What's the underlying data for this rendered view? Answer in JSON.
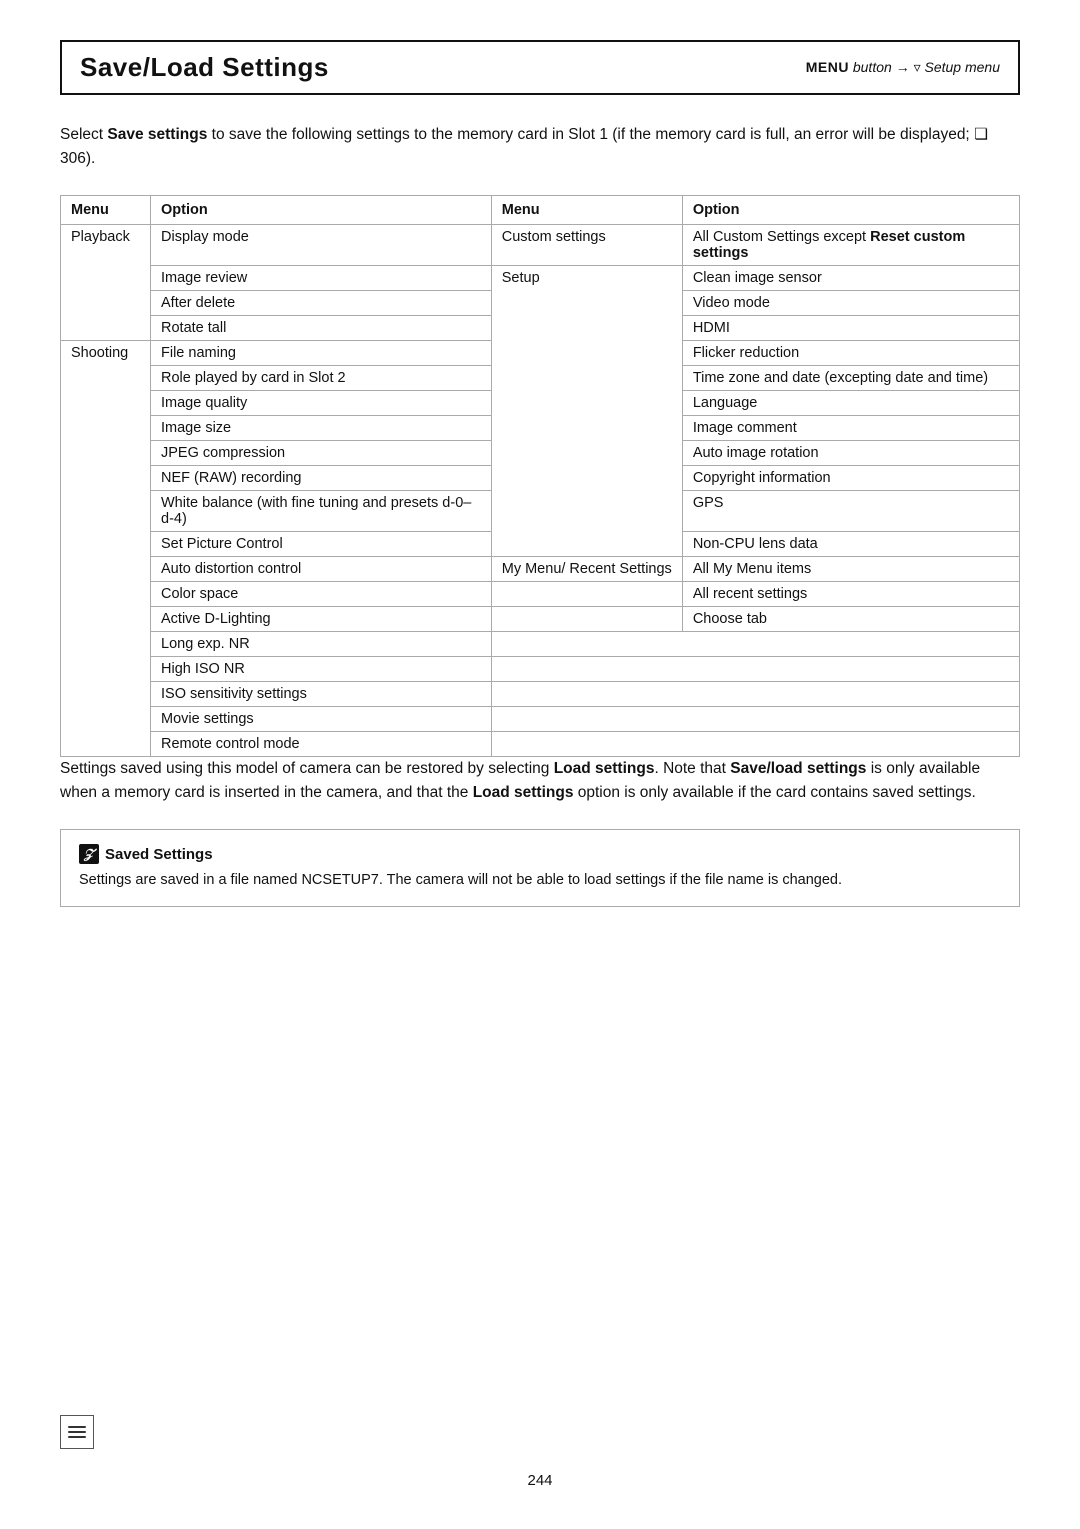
{
  "header": {
    "title": "Save/Load Settings",
    "menu_label": "MENU",
    "menu_italic": "button",
    "arrow": "→",
    "setup_icon": "Y",
    "setup_label": "Setup menu"
  },
  "intro": {
    "text_before": "Select ",
    "bold1": "Save settings",
    "text_middle": " to save the following settings to the memory card in Slot 1 (if the memory card is full, an error will be displayed; ",
    "ref": "❏ 306",
    "text_end": ")."
  },
  "table": {
    "col1_header_menu": "Menu",
    "col1_header_option": "Option",
    "col2_header_menu": "Menu",
    "col2_header_option": "Option",
    "left_rows": [
      {
        "menu": "Playback",
        "options": [
          "Display mode",
          "Image review",
          "After delete",
          "Rotate tall"
        ]
      },
      {
        "menu": "Shooting",
        "options": [
          "File naming",
          "Role played by card in Slot 2",
          "Image quality",
          "Image size",
          "JPEG compression",
          "NEF (RAW) recording",
          "White balance (with fine tuning and presets d-0–d-4)",
          "Set Picture Control",
          "Auto distortion control",
          "Color space",
          "Active D-Lighting",
          "Long exp.  NR",
          "High ISO NR",
          "ISO sensitivity settings",
          "Movie settings",
          "Remote control mode"
        ]
      }
    ],
    "right_rows": [
      {
        "menu": "Custom settings",
        "options": [
          "All Custom Settings except Reset custom settings"
        ]
      },
      {
        "menu": "Setup",
        "options": [
          "Clean image sensor",
          "Video mode",
          "HDMI",
          "Flicker reduction",
          "Time zone and date (excepting date and time)",
          "Language",
          "Image comment",
          "Auto image rotation",
          "Copyright information",
          "GPS",
          "Non-CPU lens data"
        ]
      },
      {
        "menu": "My Menu/ Recent Settings",
        "options": [
          "All My Menu items",
          "All recent settings",
          "Choose tab"
        ]
      }
    ]
  },
  "bottom_text": {
    "text1": "Settings saved using this model of camera can be restored by selecting ",
    "bold1": "Load settings",
    "text2": ".  Note that ",
    "bold2": "Save/load settings",
    "text3": " is only available when a memory card is inserted in the camera, and that the ",
    "bold3": "Load settings",
    "text4": " option is only available if the card contains saved settings."
  },
  "note": {
    "icon": "Z",
    "title": "Saved Settings",
    "text": "Settings are saved in a file named NCSETUP7.  The camera will not be able to load settings if the file name is changed."
  },
  "page_number": "244"
}
